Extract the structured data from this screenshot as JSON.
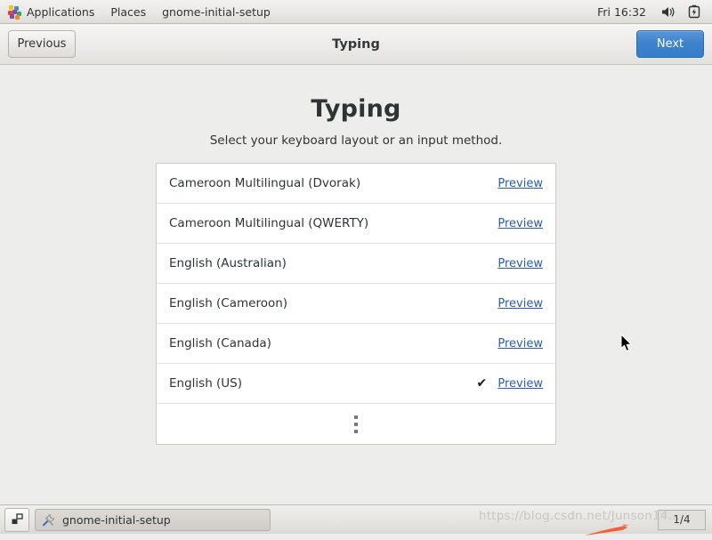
{
  "top_panel": {
    "apps_icon": "applications-grid-icon",
    "applications_label": "Applications",
    "places_label": "Places",
    "window_menu_label": "gnome-initial-setup",
    "clock": "Fri 16:32",
    "volume_icon": "volume-icon",
    "battery_icon": "battery-charging-icon"
  },
  "headerbar": {
    "previous_label": "Previous",
    "title": "Typing",
    "next_label": "Next",
    "next_color": "#3d82cd"
  },
  "page": {
    "title": "Typing",
    "subtitle": "Select your keyboard layout or an input method."
  },
  "layout_list": {
    "preview_label": "Preview",
    "check_glyph": "✔",
    "more_icon": "more-vertical-icon",
    "link_color": "#2a5db0",
    "rows": [
      {
        "name": "Cameroon Multilingual (Dvorak)",
        "selected": false
      },
      {
        "name": "Cameroon Multilingual (QWERTY)",
        "selected": false
      },
      {
        "name": "English (Australian)",
        "selected": false
      },
      {
        "name": "English (Cameroon)",
        "selected": false
      },
      {
        "name": "English (Canada)",
        "selected": false
      },
      {
        "name": "English (US)",
        "selected": true
      }
    ]
  },
  "taskbar": {
    "show_desktop_icon": "show-desktop-icon",
    "window_icon": "tools-icon",
    "window_title": "gnome-initial-setup",
    "workspace_indicator": "1/4"
  },
  "watermark": {
    "text": "https://blog.csdn.net/Junson14..."
  }
}
